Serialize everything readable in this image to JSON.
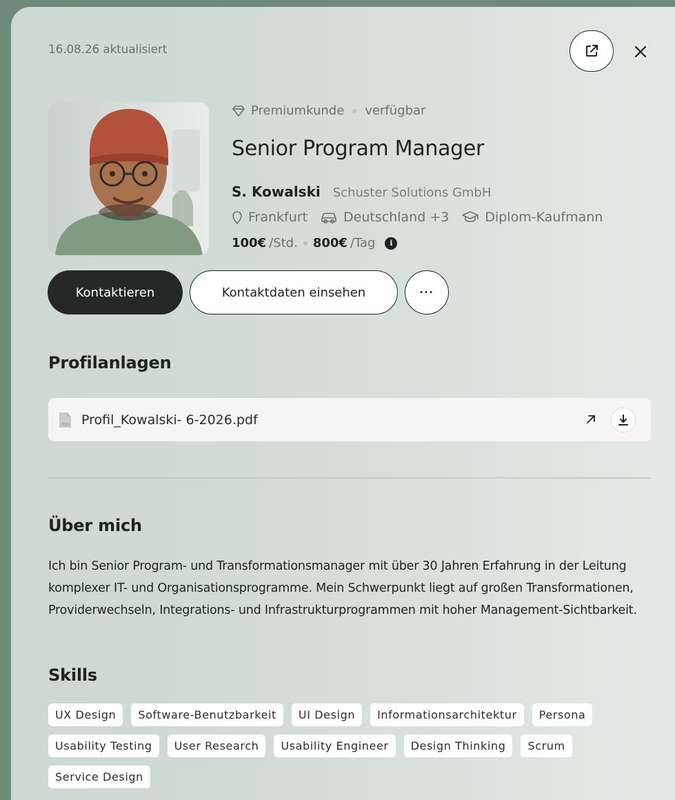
{
  "header": {
    "updated_label": "16.08.26 aktualisiert"
  },
  "profile": {
    "badge": "Premiumkunde",
    "availability": "verfügbar",
    "title": "Senior Program Manager",
    "name": "S. Kowalski",
    "company": "Schuster Solutions GmbH",
    "city": "Frankfurt",
    "mobility": "Deutschland +3",
    "degree": "Diplom-Kaufmann",
    "hourly_rate": "100€",
    "hourly_unit": "/Std.",
    "daily_rate": "800€",
    "daily_unit": "/Tag",
    "info_glyph": "i"
  },
  "actions": {
    "contact_label": "Kontaktieren",
    "view_contact_label": "Kontaktdaten einsehen",
    "more_label": "···"
  },
  "attachments": {
    "heading": "Profilanlagen",
    "file_name": "Profil_Kowalski- 6-2026.pdf",
    "file_icon_label": "PDF"
  },
  "about": {
    "heading": "Über mich",
    "text": "Ich bin Senior Program- und Transformationsmanager mit über 30 Jahren Erfahrung in der Leitung komplexer IT- und Organisationsprogramme. Mein Schwerpunkt liegt auf großen Transformationen, Providerwechseln, Integrations- und Infrastrukturprogrammen mit hoher Management-Sichtbarkeit."
  },
  "skills": {
    "heading": "Skills",
    "items": [
      "UX Design",
      "Software-Benutzbarkeit",
      "UI Design",
      "Informationsarchitektur",
      "Persona",
      "Usability Testing",
      "User Research",
      "Usability Engineer",
      "Design Thinking",
      "Scrum",
      "Service Design"
    ]
  },
  "icons": {
    "external": "external-link-icon",
    "close": "close-icon",
    "badge": "diamond-icon",
    "location": "location-pin-icon",
    "car": "car-icon",
    "degree": "graduation-cap-icon",
    "info": "info-icon",
    "file": "pdf-file-icon",
    "open": "arrow-up-right-icon",
    "download": "download-icon"
  },
  "colors": {
    "background": "#6f8a78",
    "panel": "#d4ddd8",
    "primary_button": "#262827",
    "text": "#1f2321",
    "muted": "#6d716f"
  }
}
